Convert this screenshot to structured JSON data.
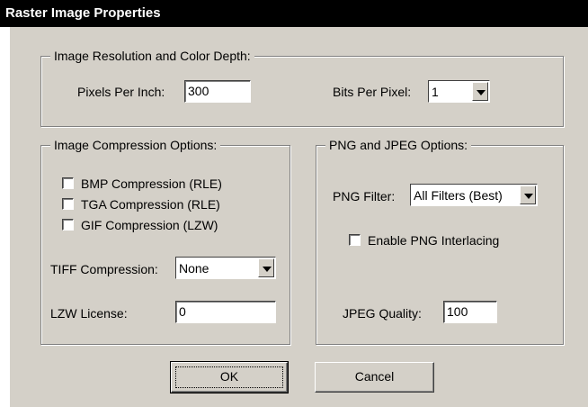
{
  "window": {
    "title": "Raster Image Properties"
  },
  "resolution_group": {
    "legend": "Image Resolution and Color Depth:",
    "ppi_label": "Pixels Per Inch:",
    "ppi_value": "300",
    "bpp_label": "Bits Per Pixel:",
    "bpp_value": "1"
  },
  "compression_group": {
    "legend": "Image Compression Options:",
    "checkboxes": [
      {
        "label": "BMP Compression (RLE)",
        "checked": false
      },
      {
        "label": "TGA Compression (RLE)",
        "checked": false
      },
      {
        "label": "GIF Compression (LZW)",
        "checked": false
      }
    ],
    "tiff_label": "TIFF Compression:",
    "tiff_value": "None",
    "lzw_label": "LZW License:",
    "lzw_value": "0"
  },
  "png_jpeg_group": {
    "legend": "PNG and JPEG Options:",
    "png_filter_label": "PNG Filter:",
    "png_filter_value": "All Filters (Best)",
    "interlace_label": "Enable PNG Interlacing",
    "interlace_checked": false,
    "jpeg_label": "JPEG Quality:",
    "jpeg_value": "100"
  },
  "buttons": {
    "ok": "OK",
    "cancel": "Cancel"
  }
}
